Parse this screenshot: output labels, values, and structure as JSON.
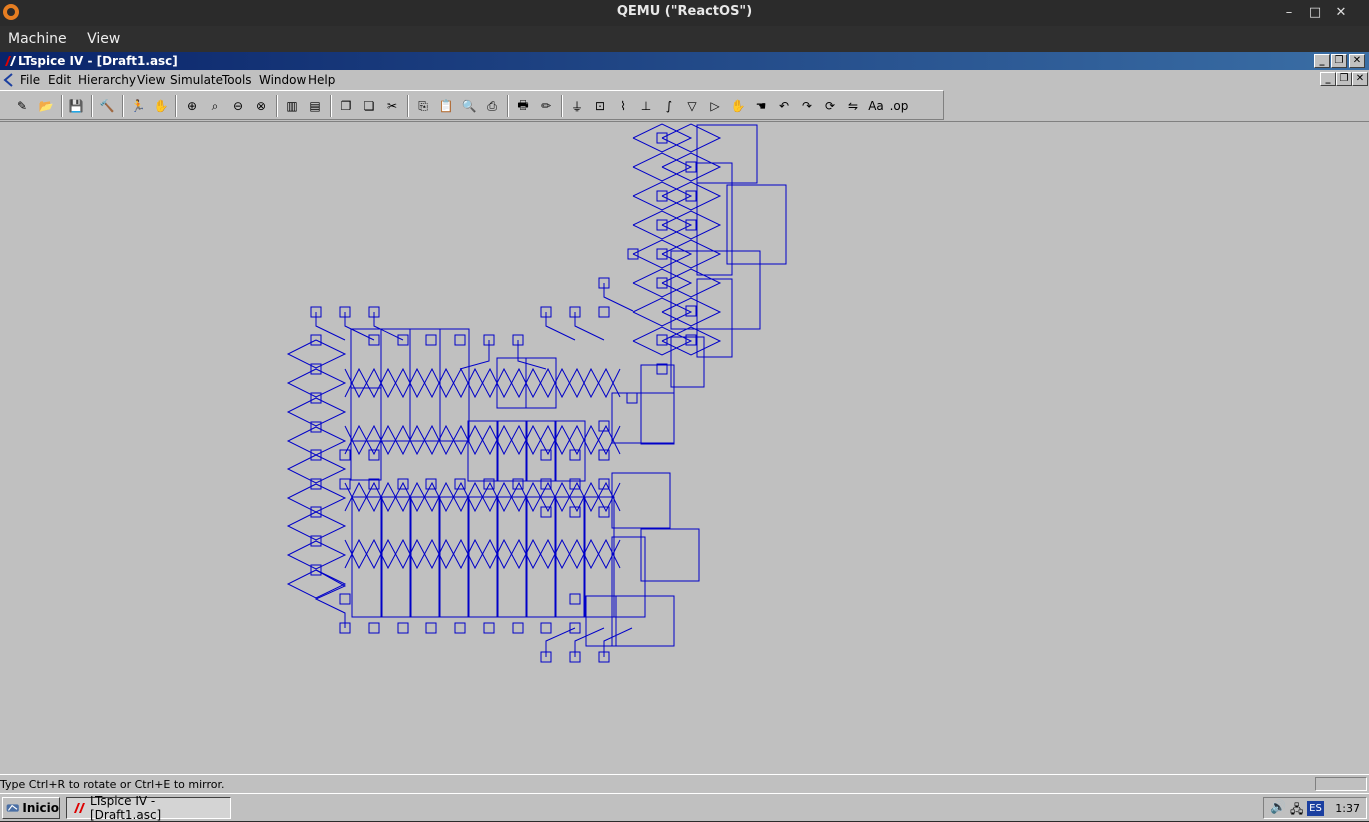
{
  "host": {
    "title": "QEMU (\"ReactOS\")",
    "menu": [
      "Machine",
      "View"
    ],
    "controls": {
      "minimize": "–",
      "maximize": "□",
      "close": "✕"
    }
  },
  "app": {
    "title": "LTspice IV - [Draft1.asc]",
    "menu": [
      "File",
      "Edit",
      "Hierarchy",
      "View",
      "Simulate",
      "Tools",
      "Window",
      "Help"
    ],
    "toolbar_icons": [
      "new-schematic-icon",
      "open-icon",
      "save-icon",
      "control-panel-icon",
      "run-icon",
      "halt-icon",
      "zoom-in-icon",
      "pan-icon",
      "zoom-out-icon",
      "zoom-fit-icon",
      "tile-vertical-icon",
      "tile-horizontal-icon",
      "cascade-icon",
      "close-all-icon",
      "cut-icon",
      "copy-icon",
      "paste-icon",
      "find-icon",
      "print-setup-icon",
      "print-icon",
      "wire-icon",
      "ground-icon",
      "label-net-icon",
      "resistor-icon",
      "capacitor-icon",
      "inductor-icon",
      "diode-icon",
      "component-icon",
      "move-icon",
      "drag-icon",
      "undo-icon",
      "redo-icon",
      "rotate-icon",
      "mirror-icon",
      "text-icon",
      "spice-directive-icon"
    ],
    "toolbar_glyphs": [
      "✎",
      "📂",
      "💾",
      "🔨",
      "🏃",
      "✋",
      "⊕",
      "⌕",
      "⊖",
      "⊗",
      "▥",
      "▤",
      "❐",
      "❏",
      "✂",
      "⎘",
      "📋",
      "🔍",
      "⎙",
      "🖶",
      "✏",
      "⏚",
      "⊡",
      "⌇",
      "⊥",
      "∫",
      "▽",
      "▷",
      "✋",
      "☚",
      "↶",
      "↷",
      "⟳",
      "⇋",
      "Aa",
      ".op"
    ],
    "status": "Type Ctrl+R to rotate or Ctrl+E to mirror.",
    "colors": {
      "schematic": "#0000c8",
      "background": "#c0c0c0"
    }
  },
  "taskbar": {
    "start": "Inicio",
    "task": "LTspice IV - [Draft1.asc]",
    "lang": "ES",
    "clock": "1:37"
  }
}
